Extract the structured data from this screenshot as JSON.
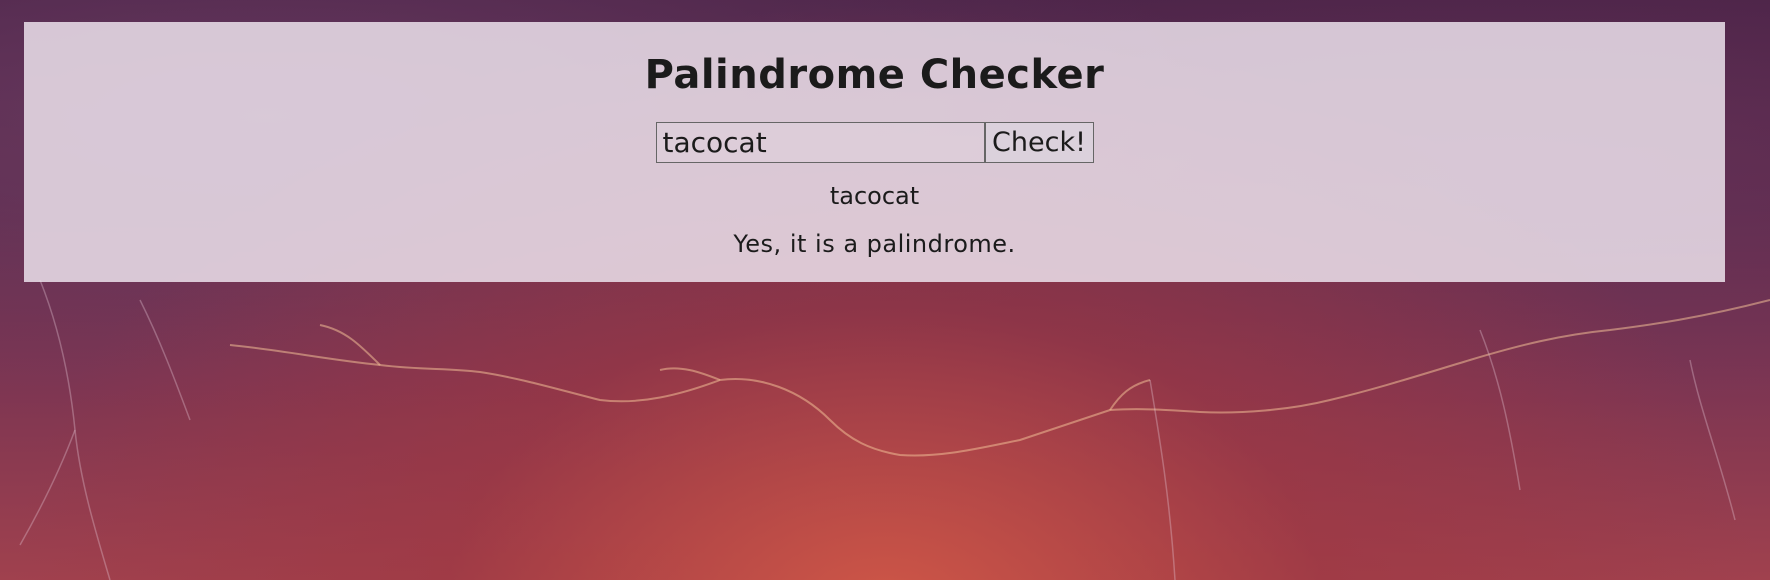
{
  "app": {
    "title": "Palindrome Checker"
  },
  "form": {
    "input_value": "tacocat",
    "button_label": "Check!"
  },
  "output": {
    "echo": "tacocat",
    "result": "Yes, it is a palindrome."
  },
  "colors": {
    "panel_background": "#ebe1eb",
    "text": "#1b1b1b",
    "background_accent": "#a0414e"
  }
}
